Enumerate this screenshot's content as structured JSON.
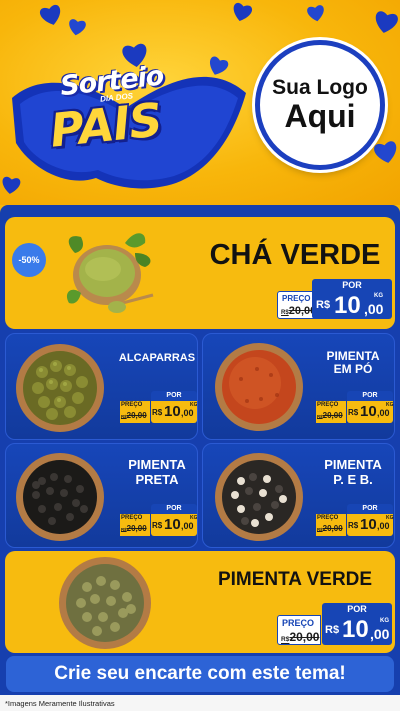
{
  "header": {
    "promo_top": "Sorteio",
    "promo_sub": "DIA DOS",
    "promo_main": "PAIS",
    "logo_line1": "Sua Logo",
    "logo_line2": "Aqui"
  },
  "colors": {
    "background_yellow": "#f6b70b",
    "panel_blue": "#163fae",
    "cta_blue": "#2d63d6",
    "card_yellow": "#f7bb0f"
  },
  "featured": {
    "badge": "-50%",
    "name": "CHÁ VERDE",
    "por": "POR",
    "preco": "PREÇO",
    "old_currency": "R$",
    "old_price": "20,00",
    "currency": "R$",
    "price_int": "10",
    "price_dec": ",00",
    "unit": "KG"
  },
  "products": [
    {
      "name": "ALCAPARRAS",
      "por": "POR",
      "preco": "PREÇO",
      "old_currency": "R$",
      "old_price": "20,00",
      "currency": "R$",
      "price_int": "10",
      "price_dec": ",00",
      "unit": "KG"
    },
    {
      "name_l1": "PIMENTA",
      "name_l2": "EM PÓ",
      "por": "POR",
      "preco": "PREÇO",
      "old_currency": "R$",
      "old_price": "20,00",
      "currency": "R$",
      "price_int": "10",
      "price_dec": ",00",
      "unit": "KG"
    },
    {
      "name_l1": "PIMENTA",
      "name_l2": "PRETA",
      "por": "POR",
      "preco": "PREÇO",
      "old_currency": "R$",
      "old_price": "20,00",
      "currency": "R$",
      "price_int": "10",
      "price_dec": ",00",
      "unit": "KG"
    },
    {
      "name_l1": "PIMENTA",
      "name_l2": "P. E B.",
      "por": "POR",
      "preco": "PREÇO",
      "old_currency": "R$",
      "old_price": "20,00",
      "currency": "R$",
      "price_int": "10",
      "price_dec": ",00",
      "unit": "KG"
    }
  ],
  "bottom_featured": {
    "name": "PIMENTA VERDE",
    "por": "POR",
    "preco": "PREÇO",
    "old_currency": "R$",
    "old_price": "20,00",
    "currency": "R$",
    "price_int": "10",
    "price_dec": ",00",
    "unit": "KG"
  },
  "cta": "Crie seu encarte com este tema!",
  "footer_note": "*Imagens Meramente Ilustrativas"
}
